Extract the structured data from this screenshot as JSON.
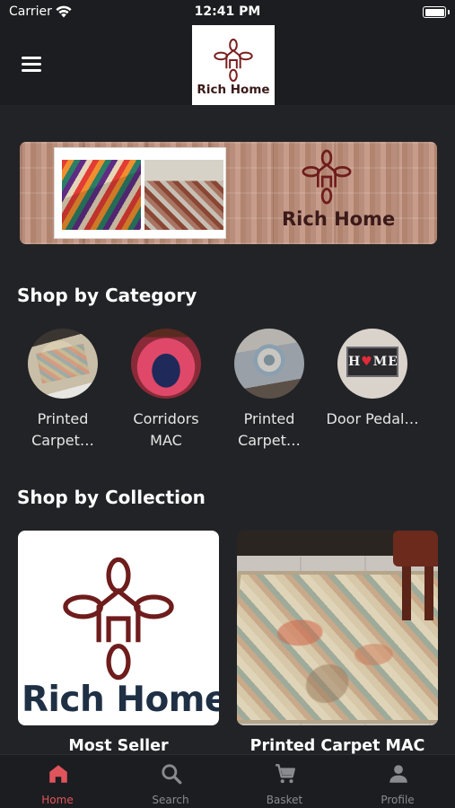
{
  "status_bar": {
    "carrier": "Carrier",
    "time": "12:41 PM"
  },
  "header": {
    "logo_text": "Rich Home",
    "menu_icon": "hamburger-menu-icon",
    "brand_color": "#7a1f1f"
  },
  "banner": {
    "logo_text": "Rich Home"
  },
  "sections": {
    "category_title": "Shop by Category",
    "collection_title": "Shop by Collection"
  },
  "categories": [
    {
      "label": "Printed Carpet…"
    },
    {
      "label": "Corridors MAC"
    },
    {
      "label": "Printed Carpet…"
    },
    {
      "label": "Door Pedal…"
    }
  ],
  "door_mat_text": {
    "left": "H",
    "heart": "♥",
    "right": "ME"
  },
  "collections": [
    {
      "title": "Most Seller",
      "image_text": "Rich Home"
    },
    {
      "title": "Printed Carpet MAC"
    }
  ],
  "tab_bar": {
    "active_color": "#e0545c",
    "inactive_color": "#8a8b8f",
    "tabs": [
      {
        "label": "Home",
        "icon": "home-icon",
        "active": true
      },
      {
        "label": "Search",
        "icon": "search-icon",
        "active": false
      },
      {
        "label": "Basket",
        "icon": "cart-icon",
        "active": false
      },
      {
        "label": "Profile",
        "icon": "person-icon",
        "active": false
      }
    ]
  }
}
